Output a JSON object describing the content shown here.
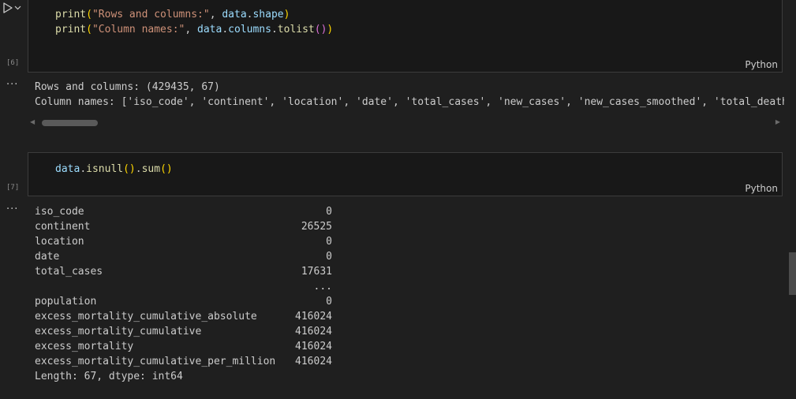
{
  "cell6": {
    "execution_count": "[6]",
    "language": "Python",
    "code": {
      "line1": {
        "fn": "print",
        "open": "(",
        "str": "\"Rows and columns:\"",
        "comma": ", ",
        "obj": "data",
        "dot": ".",
        "attr": "shape",
        "close": ")"
      },
      "line2": {
        "fn": "print",
        "open": "(",
        "str": "\"Column names:\"",
        "comma": ", ",
        "obj": "data",
        "dot1": ".",
        "attr": "columns",
        "dot2": ".",
        "method": "tolist",
        "call": "()",
        "close": ")"
      }
    },
    "output": {
      "line1": "Rows and columns: (429435, 67)",
      "line2": "Column names: ['iso_code', 'continent', 'location', 'date', 'total_cases', 'new_cases', 'new_cases_smoothed', 'total_deaths"
    }
  },
  "cell7": {
    "execution_count": "[7]",
    "language": "Python",
    "code": {
      "obj": "data",
      "dot1": ".",
      "method1": "isnull",
      "call1": "()",
      "dot2": ".",
      "method2": "sum",
      "call2": "()"
    },
    "output": {
      "rows": [
        {
          "name": "iso_code",
          "value": "0"
        },
        {
          "name": "continent",
          "value": "26525"
        },
        {
          "name": "location",
          "value": "0"
        },
        {
          "name": "date",
          "value": "0"
        },
        {
          "name": "total_cases",
          "value": "17631"
        },
        {
          "name": "",
          "value": "..."
        },
        {
          "name": "population",
          "value": "0"
        },
        {
          "name": "excess_mortality_cumulative_absolute",
          "value": "416024"
        },
        {
          "name": "excess_mortality_cumulative",
          "value": "416024"
        },
        {
          "name": "excess_mortality",
          "value": "416024"
        },
        {
          "name": "excess_mortality_cumulative_per_million",
          "value": "416024"
        }
      ],
      "footer": "Length: 67, dtype: int64"
    }
  },
  "output_menu_glyph": "···",
  "icons": {
    "run": "play-icon",
    "chevron": "chevron-down-icon"
  }
}
